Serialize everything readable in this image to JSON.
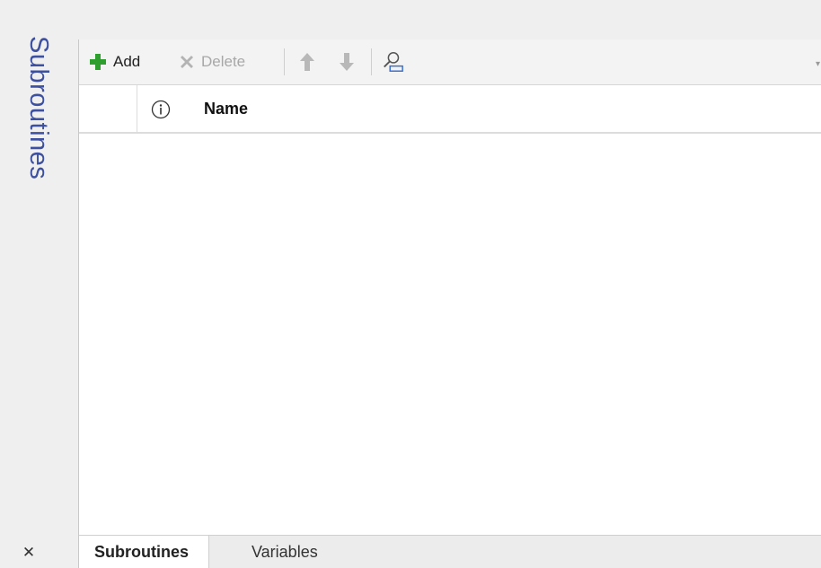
{
  "side_panel": {
    "title": "Subroutines",
    "close_symbol": "✕"
  },
  "toolbar": {
    "add_label": "Add",
    "delete_label": "Delete",
    "icons": {
      "add": "plus-icon",
      "delete": "delete-x-icon",
      "move_up": "arrow-up-icon",
      "move_down": "arrow-down-icon",
      "find": "search-icon"
    },
    "add_icon_color": "#2e9e2e",
    "overflow_symbol": "▾"
  },
  "grid": {
    "columns": [
      {
        "label": "",
        "icon": "info-icon"
      },
      {
        "label": "Name"
      }
    ],
    "rows": []
  },
  "tabs": [
    {
      "label": "Subroutines",
      "active": true
    },
    {
      "label": "Variables",
      "active": false
    }
  ],
  "colors": {
    "side_title": "#3d4f9f",
    "disabled_text": "#a8a8a8"
  }
}
